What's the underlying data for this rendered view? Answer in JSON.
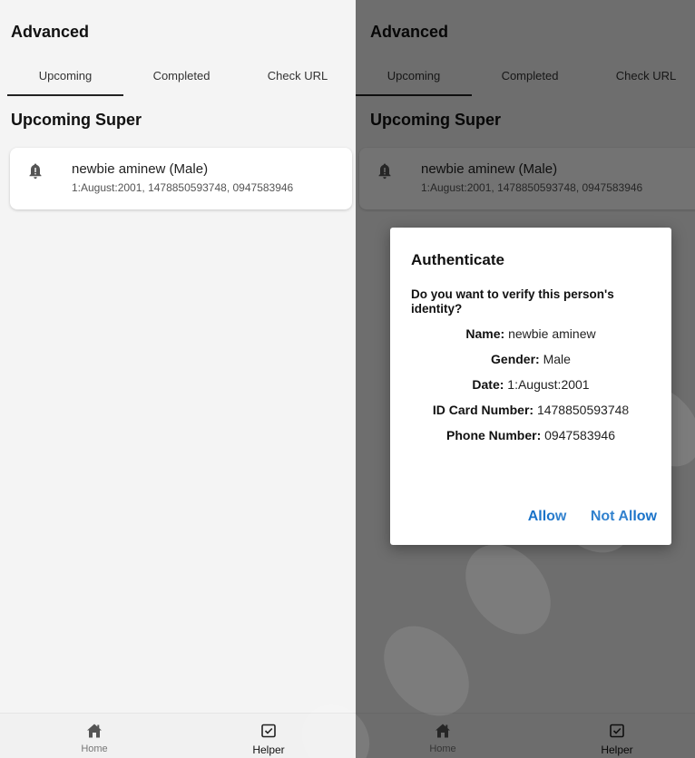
{
  "app": {
    "title": "Advanced"
  },
  "tabs": [
    {
      "label": "Upcoming"
    },
    {
      "label": "Completed"
    },
    {
      "label": "Check URL"
    }
  ],
  "section_title": "Upcoming Super",
  "card": {
    "icon": "bell-alert-icon",
    "name": "newbie aminew (Male)",
    "details": "1:August:2001, 1478850593748, 0947583946"
  },
  "bottom_nav": [
    {
      "label": "Home",
      "icon": "home-icon"
    },
    {
      "label": "Helper",
      "icon": "checkbox-calendar-icon",
      "active": true
    }
  ],
  "dialog": {
    "title": "Authenticate",
    "question": "Do you want to verify this person's identity?",
    "rows": [
      {
        "label": "Name:",
        "value": " newbie aminew"
      },
      {
        "label": "Gender:",
        "value": " Male"
      },
      {
        "label": "Date:",
        "value": " 1:August:2001"
      },
      {
        "label": "ID Card Number:",
        "value": " 1478850593748"
      },
      {
        "label": "Phone Number:",
        "value": " 0947583946"
      }
    ],
    "allow_label": "Allow",
    "not_allow_label": "Not Allow"
  },
  "colors": {
    "accent": "#1a73c9",
    "scrim": "#000000"
  }
}
